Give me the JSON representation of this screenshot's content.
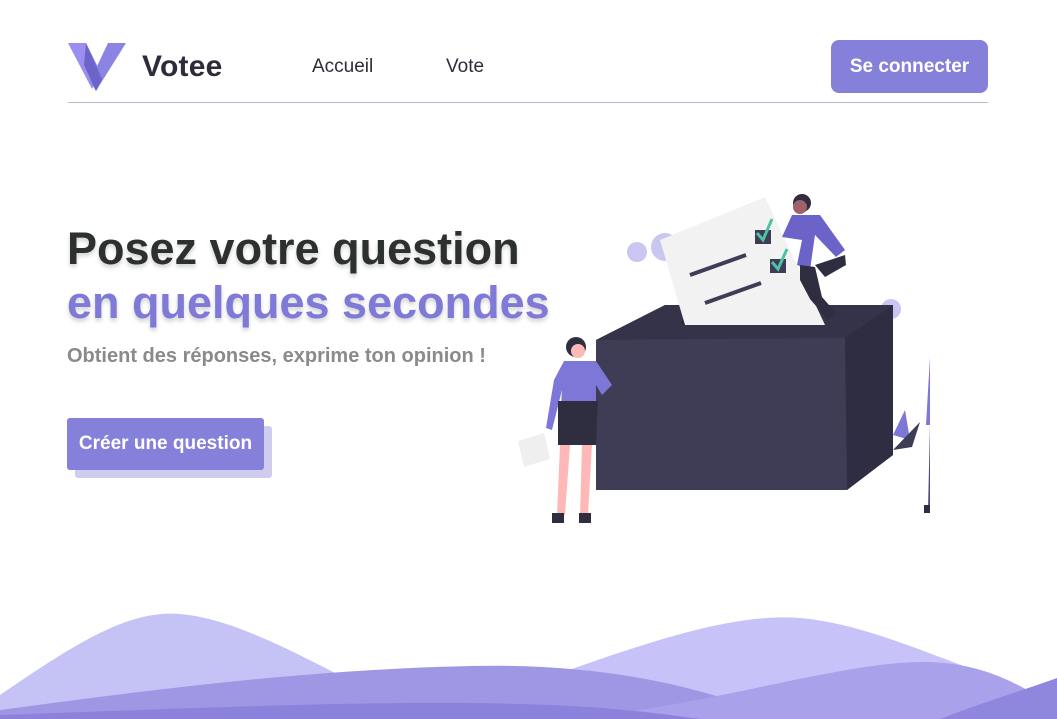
{
  "brand": {
    "name": "Votee",
    "logo_icon": "v-logo-icon"
  },
  "nav": {
    "links": [
      "Accueil",
      "Vote"
    ],
    "login_label": "Se connecter"
  },
  "hero": {
    "title_line1": "Posez votre question",
    "title_line2": "en quelques secondes",
    "subtitle": "Obtient des réponses, exprime ton opinion !",
    "cta_label": "Créer une question",
    "illustration": "voting-ballot-box-illustration"
  },
  "colors": {
    "accent": "#8580da",
    "heading": "#2c302e",
    "subtitle": "#8a8a8a",
    "ballot_box": "#3f3d56"
  }
}
